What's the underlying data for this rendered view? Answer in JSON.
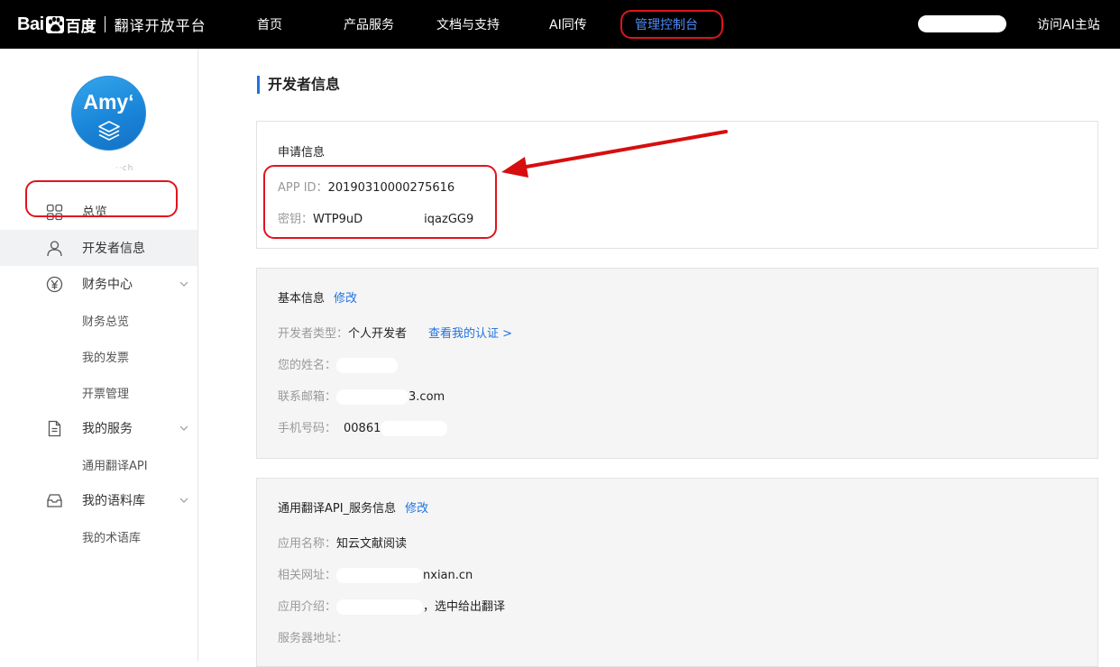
{
  "header": {
    "logo_bai": "Bai",
    "logo_baidu_cn": "百度",
    "product": "翻译开放平台",
    "nav": [
      {
        "label": "首页"
      },
      {
        "label": "产品服务"
      },
      {
        "label": "文档与支持"
      },
      {
        "label": "AI同传"
      },
      {
        "label": "管理控制台",
        "active": true
      }
    ],
    "visit_link": "访问AI主站",
    "active_color": "#4e8cf7",
    "highlight_color": "#e0141e"
  },
  "sidebar": {
    "avatar_text": "Amy‘",
    "user_name_hint": "··ch",
    "items": [
      {
        "label": "总览",
        "icon": "grid-icon"
      },
      {
        "label": "开发者信息",
        "icon": "user-icon",
        "active": true
      },
      {
        "label": "财务中心",
        "icon": "yen-icon",
        "expandable": true
      },
      {
        "label": "财务总览",
        "sub": true
      },
      {
        "label": "我的发票",
        "sub": true
      },
      {
        "label": "开票管理",
        "sub": true
      },
      {
        "label": "我的服务",
        "icon": "document-icon",
        "expandable": true
      },
      {
        "label": "通用翻译API",
        "sub": true
      },
      {
        "label": "我的语料库",
        "icon": "inbox-icon",
        "expandable": true
      },
      {
        "label": "我的术语库",
        "sub": true
      }
    ]
  },
  "main": {
    "title": "开发者信息",
    "application": {
      "heading": "申请信息",
      "app_id_label": "APP ID：",
      "app_id_value": "20190310000275616",
      "secret_label": "密钥：",
      "secret_prefix": "WTP9uD",
      "secret_suffix": "iqazGG9"
    },
    "basic": {
      "heading": "基本信息",
      "edit": "修改",
      "type_label": "开发者类型：",
      "type_value": "个人开发者",
      "cert_link": "查看我的认证 >",
      "name_label": "您的姓名：",
      "email_label": "联系邮箱：",
      "email_suffix": "3.com",
      "phone_label": "手机号码：",
      "phone_prefix": "00861"
    },
    "service": {
      "heading": "通用翻译API_服务信息",
      "edit": "修改",
      "app_name_label": "应用名称：",
      "app_name_value": "知云文献阅读",
      "url_label": "相关网址：",
      "url_suffix": "nxian.cn",
      "intro_label": "应用介绍：",
      "intro_suffix": "，选中给出翻译",
      "server_label": "服务器地址："
    }
  }
}
